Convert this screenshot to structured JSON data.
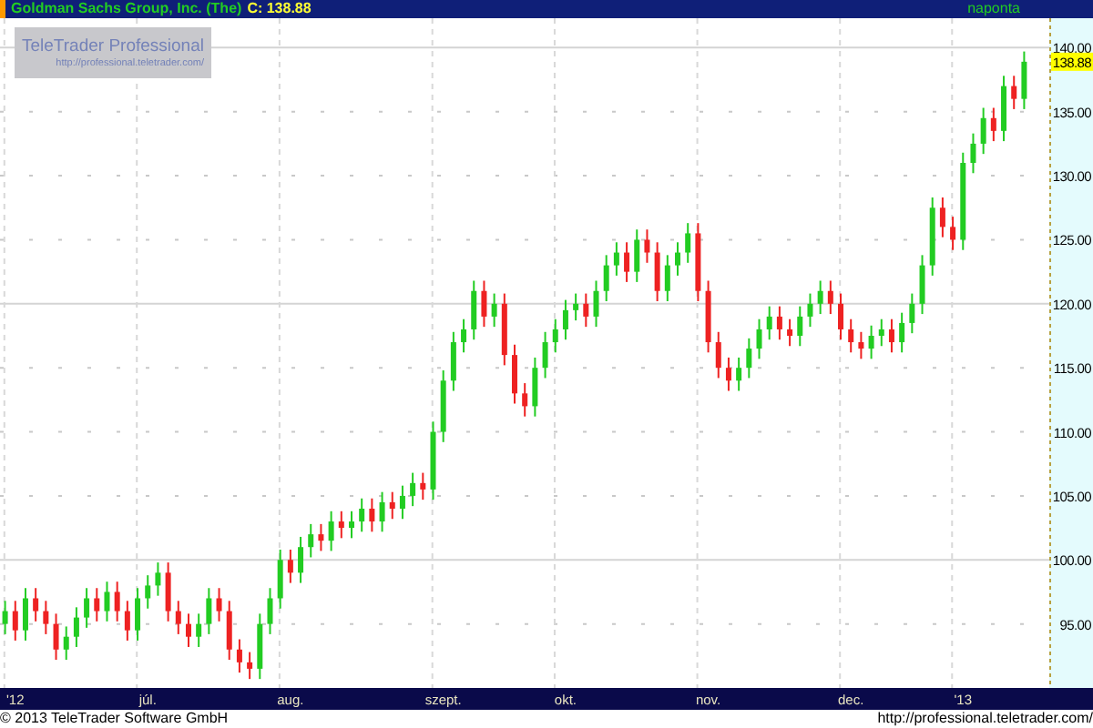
{
  "header": {
    "title": "Goldman Sachs Group, Inc. (The)",
    "last_close": "C: 138.88",
    "interval": "naponta"
  },
  "logo": {
    "name": "TeleTrader Professional",
    "url": "http://professional.teletrader.com/"
  },
  "chart": {
    "last_price_label": "138.88",
    "chart_data": {
      "type": "candlestick",
      "ylim": [
        90,
        142.3
      ],
      "yticks": [
        {
          "value": 95,
          "label": "95.00"
        },
        {
          "value": 100,
          "label": "100.00"
        },
        {
          "value": 105,
          "label": "105.00"
        },
        {
          "value": 110,
          "label": "110.00"
        },
        {
          "value": 115,
          "label": "115.00"
        },
        {
          "value": 120,
          "label": "120.00"
        },
        {
          "value": 125,
          "label": "125.00"
        },
        {
          "value": 130,
          "label": "130.00"
        },
        {
          "value": 135,
          "label": "135.00"
        },
        {
          "value": 140,
          "label": "140.00"
        }
      ],
      "grid": true,
      "categories": [
        null,
        "'12",
        null,
        null,
        null,
        null,
        null,
        null,
        null,
        null,
        null,
        null,
        null,
        null,
        "júl.",
        null,
        null,
        null,
        null,
        null,
        null,
        null,
        null,
        null,
        null,
        null,
        null,
        null,
        "aug.",
        null,
        null,
        null,
        null,
        null,
        null,
        null,
        null,
        null,
        null,
        null,
        null,
        null,
        null,
        "szept.",
        null,
        null,
        null,
        null,
        null,
        null,
        null,
        null,
        null,
        null,
        null,
        "okt.",
        null,
        null,
        null,
        null,
        null,
        null,
        null,
        null,
        null,
        null,
        null,
        null,
        null,
        "nov.",
        null,
        null,
        null,
        null,
        null,
        null,
        null,
        null,
        null,
        null,
        null,
        null,
        null,
        "dec.",
        null,
        null,
        null,
        null,
        null,
        null,
        null,
        null,
        null,
        null,
        "'13",
        null,
        null,
        null,
        null,
        null,
        null
      ],
      "ohlc": [
        [
          95,
          96.8,
          94.2,
          96
        ],
        [
          96,
          96.8,
          93.7,
          94.5
        ],
        [
          94.5,
          97.8,
          93.7,
          97
        ],
        [
          97,
          97.8,
          95.2,
          96
        ],
        [
          96,
          96.8,
          94.2,
          95
        ],
        [
          95,
          95.8,
          92.2,
          93
        ],
        [
          93,
          94.8,
          92.2,
          94
        ],
        [
          94,
          96.3,
          93.2,
          95.5
        ],
        [
          95.5,
          97.8,
          94.7,
          97
        ],
        [
          97,
          97.8,
          95.2,
          96
        ],
        [
          96,
          98.3,
          95.2,
          97.5
        ],
        [
          97.5,
          98.3,
          95.2,
          96
        ],
        [
          96,
          96.8,
          93.7,
          94.5
        ],
        [
          94.5,
          97.8,
          93.7,
          97
        ],
        [
          97,
          98.8,
          96.2,
          98
        ],
        [
          98,
          99.8,
          97.2,
          99
        ],
        [
          99,
          99.8,
          95.2,
          96
        ],
        [
          96,
          96.8,
          94.2,
          95
        ],
        [
          95,
          95.8,
          93.2,
          94
        ],
        [
          94,
          95.8,
          93.2,
          95
        ],
        [
          95,
          97.8,
          94.2,
          97
        ],
        [
          97,
          97.8,
          95.2,
          96
        ],
        [
          96,
          96.8,
          92.2,
          93
        ],
        [
          93,
          93.8,
          91.2,
          92
        ],
        [
          92,
          92.8,
          90.7,
          91.5
        ],
        [
          91.5,
          95.8,
          90.7,
          95
        ],
        [
          95,
          97.8,
          94.2,
          97
        ],
        [
          97,
          100.8,
          96.2,
          100
        ],
        [
          100,
          100.8,
          98.2,
          99
        ],
        [
          99,
          101.8,
          98.2,
          101
        ],
        [
          101,
          102.8,
          100.2,
          102
        ],
        [
          102,
          102.8,
          100.7,
          101.5
        ],
        [
          101.5,
          103.8,
          100.7,
          103
        ],
        [
          103,
          103.8,
          101.7,
          102.5
        ],
        [
          102.5,
          103.8,
          101.7,
          103
        ],
        [
          103,
          104.8,
          102.2,
          104
        ],
        [
          104,
          104.8,
          102.2,
          103
        ],
        [
          103,
          105.3,
          102.2,
          104.5
        ],
        [
          104.5,
          105.3,
          103.2,
          104
        ],
        [
          104,
          105.8,
          103.2,
          105
        ],
        [
          105,
          106.8,
          104.2,
          106
        ],
        [
          106,
          106.8,
          104.7,
          105.5
        ],
        [
          105.5,
          110.8,
          104.7,
          110
        ],
        [
          110,
          114.8,
          109.2,
          114
        ],
        [
          114,
          117.8,
          113.2,
          117
        ],
        [
          117,
          118.8,
          116.2,
          118
        ],
        [
          118,
          121.8,
          117.2,
          121
        ],
        [
          121,
          121.8,
          118.2,
          119
        ],
        [
          119,
          120.8,
          118.2,
          120
        ],
        [
          120,
          120.8,
          115.2,
          116
        ],
        [
          116,
          116.8,
          112.2,
          113
        ],
        [
          113,
          113.8,
          111.2,
          112
        ],
        [
          112,
          115.8,
          111.2,
          115
        ],
        [
          115,
          117.8,
          114.2,
          117
        ],
        [
          117,
          118.8,
          116.2,
          118
        ],
        [
          118,
          120.3,
          117.2,
          119.5
        ],
        [
          119.5,
          120.8,
          118.7,
          120
        ],
        [
          120,
          120.8,
          118.2,
          119
        ],
        [
          119,
          121.8,
          118.2,
          121
        ],
        [
          121,
          123.8,
          120.2,
          123
        ],
        [
          123,
          124.8,
          122.2,
          124
        ],
        [
          124,
          124.8,
          121.7,
          122.5
        ],
        [
          122.5,
          125.8,
          121.7,
          125
        ],
        [
          125,
          125.8,
          123.2,
          124
        ],
        [
          124,
          124.8,
          120.2,
          121
        ],
        [
          121,
          123.8,
          120.2,
          123
        ],
        [
          123,
          124.8,
          122.2,
          124
        ],
        [
          124,
          126.3,
          123.2,
          125.5
        ],
        [
          125.5,
          126.3,
          120.2,
          121
        ],
        [
          121,
          121.8,
          116.2,
          117
        ],
        [
          117,
          117.8,
          114.2,
          115
        ],
        [
          115,
          115.8,
          113.2,
          114
        ],
        [
          114,
          115.8,
          113.2,
          115
        ],
        [
          115,
          117.3,
          114.2,
          116.5
        ],
        [
          116.5,
          118.8,
          115.7,
          118
        ],
        [
          118,
          119.8,
          117.2,
          119
        ],
        [
          119,
          119.8,
          117.2,
          118
        ],
        [
          118,
          118.8,
          116.7,
          117.5
        ],
        [
          117.5,
          119.8,
          116.7,
          119
        ],
        [
          119,
          120.8,
          118.2,
          120
        ],
        [
          120,
          121.8,
          119.2,
          121
        ],
        [
          121,
          121.8,
          119.2,
          120
        ],
        [
          120,
          120.8,
          117.2,
          118
        ],
        [
          118,
          118.8,
          116.2,
          117
        ],
        [
          117,
          117.8,
          115.7,
          116.5
        ],
        [
          116.5,
          118.3,
          115.7,
          117.5
        ],
        [
          117.5,
          118.8,
          116.7,
          118
        ],
        [
          118,
          118.8,
          116.2,
          117
        ],
        [
          117,
          119.3,
          116.2,
          118.5
        ],
        [
          118.5,
          120.8,
          117.7,
          120
        ],
        [
          120,
          123.8,
          119.2,
          123
        ],
        [
          123,
          128.3,
          122.2,
          127.5
        ],
        [
          127.5,
          128.3,
          125.2,
          126
        ],
        [
          126,
          126.8,
          124.2,
          125
        ],
        [
          125,
          131.8,
          124.2,
          131
        ],
        [
          131,
          133.3,
          130.2,
          132.5
        ],
        [
          132.5,
          135.3,
          131.7,
          134.5
        ],
        [
          134.5,
          135.3,
          132.7,
          133.5
        ],
        [
          133.5,
          137.8,
          132.7,
          137
        ],
        [
          137,
          137.8,
          135.2,
          136
        ],
        [
          136,
          139.7,
          135.2,
          138.9
        ]
      ]
    }
  },
  "footer": {
    "copyright": "© 2013 TeleTrader Software GmbH",
    "url": "http://professional.teletrader.com/"
  }
}
